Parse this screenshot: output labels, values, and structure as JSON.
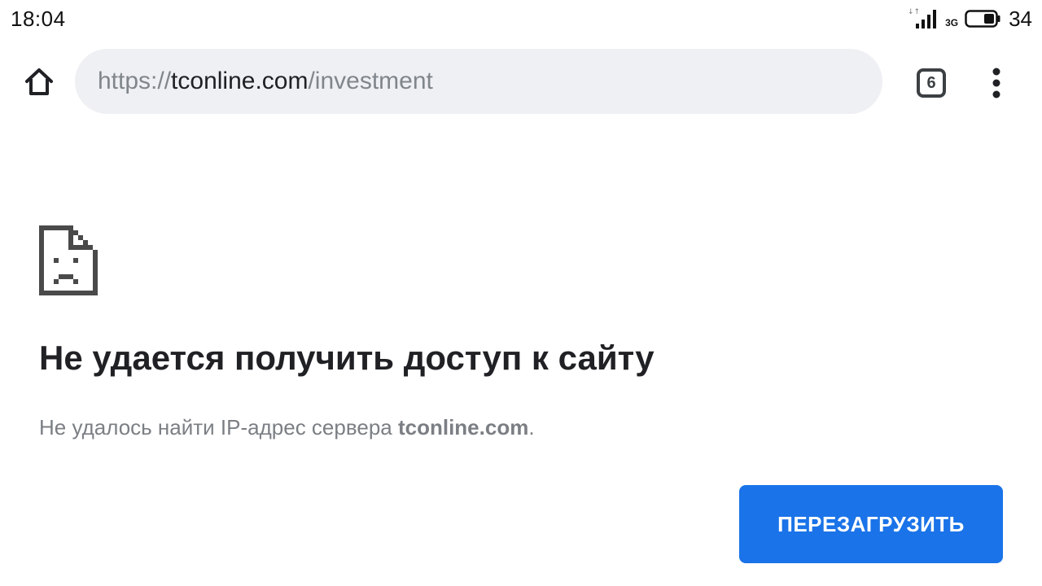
{
  "status_bar": {
    "time": "18:04",
    "network_type": "3G",
    "battery_level": "34",
    "icons": [
      "signal-icon",
      "battery-icon"
    ]
  },
  "toolbar": {
    "home_icon": "home-icon",
    "url": {
      "scheme": "https://",
      "host": "tconline.com",
      "path": "/investment"
    },
    "tab_count": "6",
    "menu_icon": "more-vertical-icon"
  },
  "error": {
    "icon": "sad-page-icon",
    "title": "Не удается получить доступ к сайту",
    "message_prefix": "Не удалось найти IP-адрес сервера ",
    "message_host": "tconline.com",
    "message_suffix": "."
  },
  "actions": {
    "reload_label": "ПЕРЕЗАГРУЗИТЬ"
  },
  "colors": {
    "omnibox_background": "#eff0f4",
    "primary_button": "#1a73e8",
    "title_text": "#202124",
    "secondary_text": "#7b7f84"
  }
}
